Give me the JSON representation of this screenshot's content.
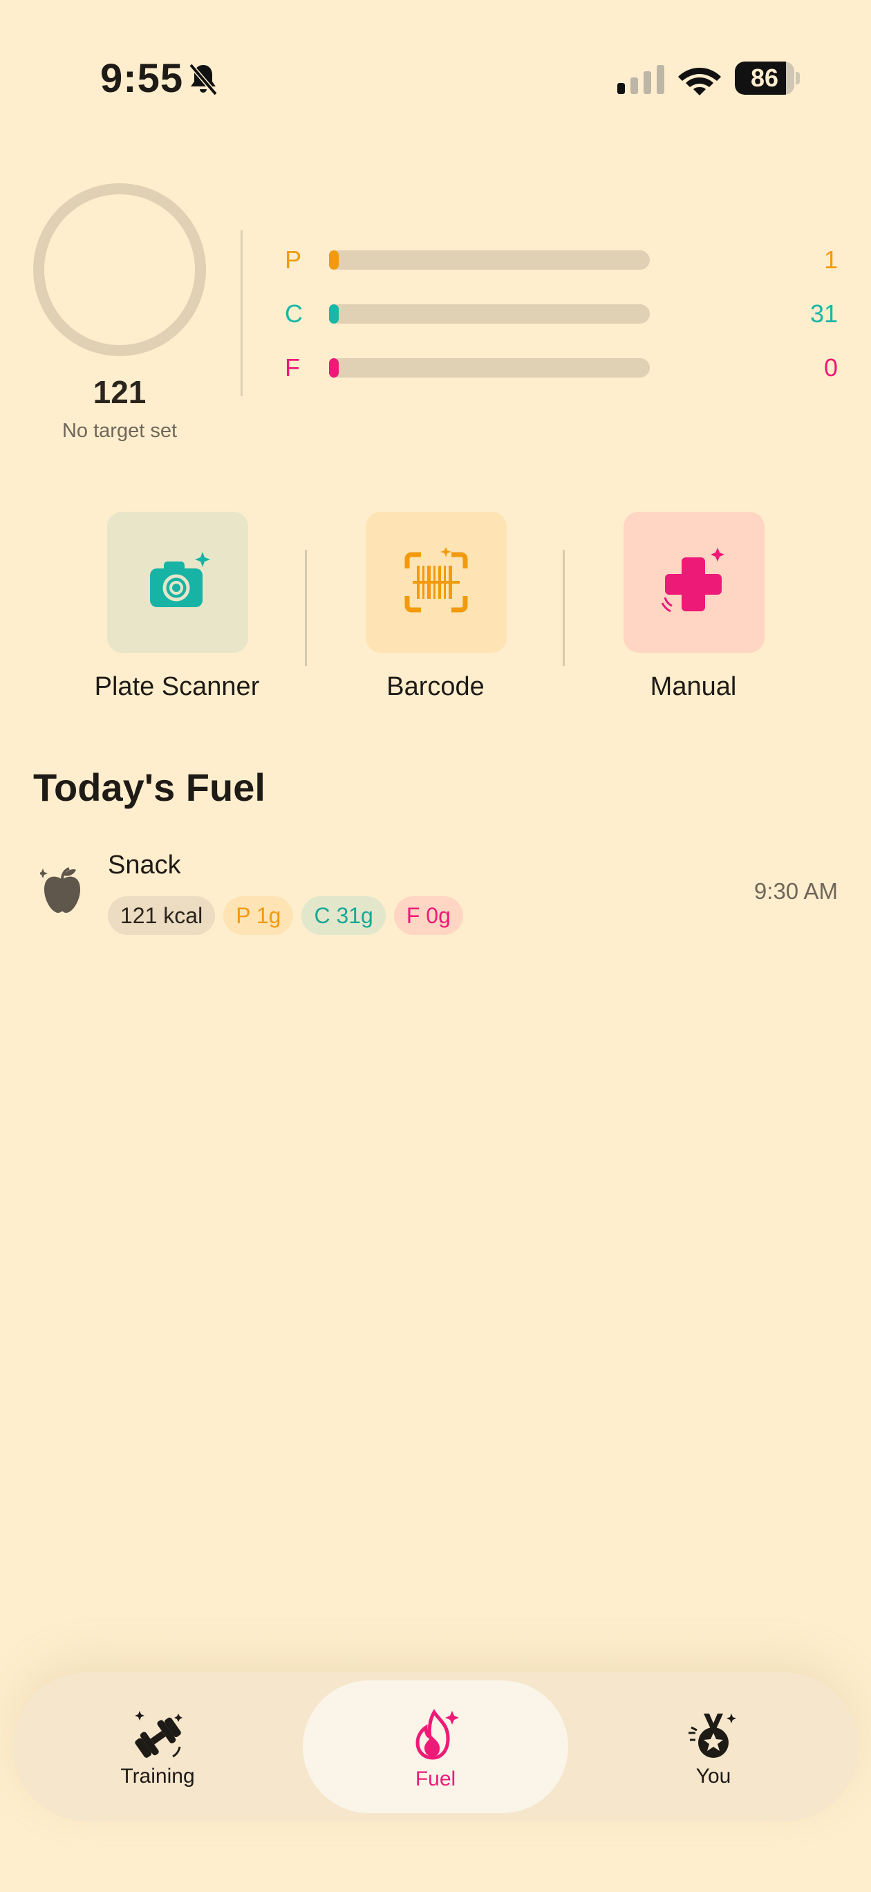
{
  "status_bar": {
    "time": "9:55",
    "battery": "86",
    "battery_level": 0.86
  },
  "summary": {
    "calories": "121",
    "target_text": "No target set",
    "macros": [
      {
        "letter": "P",
        "value": "1",
        "color": "#F29A0E",
        "fill": 0.03
      },
      {
        "letter": "C",
        "value": "31",
        "color": "#18B7A6",
        "fill": 0.03
      },
      {
        "letter": "F",
        "value": "0",
        "color": "#EE1A78",
        "fill": 0.03
      }
    ]
  },
  "actions": [
    {
      "label": "Plate Scanner",
      "icon": "camera-icon",
      "tile_color": "#E8E5C9",
      "icon_color": "#17B3A5"
    },
    {
      "label": "Barcode",
      "icon": "barcode-icon",
      "tile_color": "#FEE4B4",
      "icon_color": "#F29A0E"
    },
    {
      "label": "Manual",
      "icon": "plus-icon",
      "tile_color": "#FED6C3",
      "icon_color": "#EE1A78"
    }
  ],
  "today": {
    "title": "Today's Fuel",
    "meals": [
      {
        "name": "Snack",
        "icon": "apple-icon",
        "time": "9:30 AM",
        "kcal": "121 kcal",
        "protein": "P 1g",
        "carbs": "C 31g",
        "fat": "F 0g"
      }
    ]
  },
  "nav": {
    "items": [
      {
        "label": "Training",
        "icon": "dumbbell-icon"
      },
      {
        "label": "Fuel",
        "icon": "flame-icon",
        "active": true,
        "active_color": "#EE1A78"
      },
      {
        "label": "You",
        "icon": "medal-icon"
      }
    ]
  }
}
